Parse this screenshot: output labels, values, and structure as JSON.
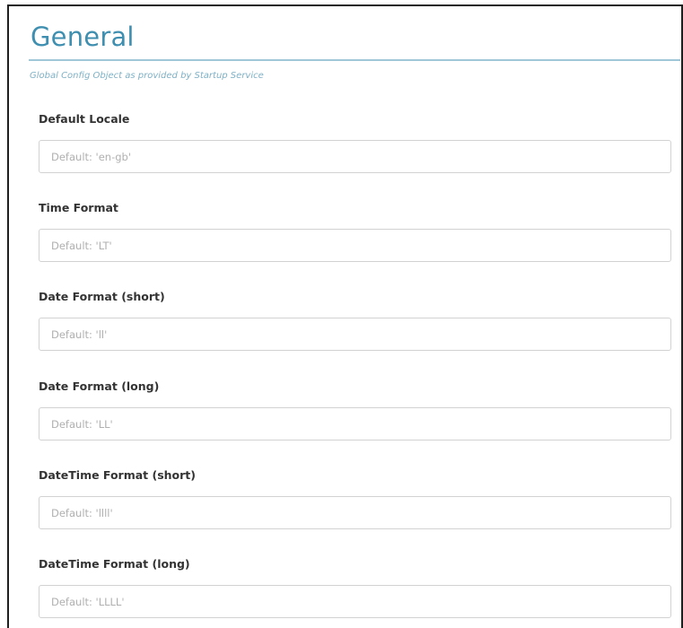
{
  "section": {
    "title": "General",
    "subtitle": "Global Config Object as provided by Startup Service"
  },
  "fields": [
    {
      "label": "Default Locale",
      "placeholder": "Default: 'en-gb'",
      "value": ""
    },
    {
      "label": "Time Format",
      "placeholder": "Default: 'LT'",
      "value": ""
    },
    {
      "label": "Date Format (short)",
      "placeholder": "Default: 'll'",
      "value": ""
    },
    {
      "label": "Date Format (long)",
      "placeholder": "Default: 'LL'",
      "value": ""
    },
    {
      "label": "DateTime Format (short)",
      "placeholder": "Default: 'llll'",
      "value": ""
    },
    {
      "label": "DateTime Format (long)",
      "placeholder": "Default: 'LLLL'",
      "value": ""
    }
  ]
}
